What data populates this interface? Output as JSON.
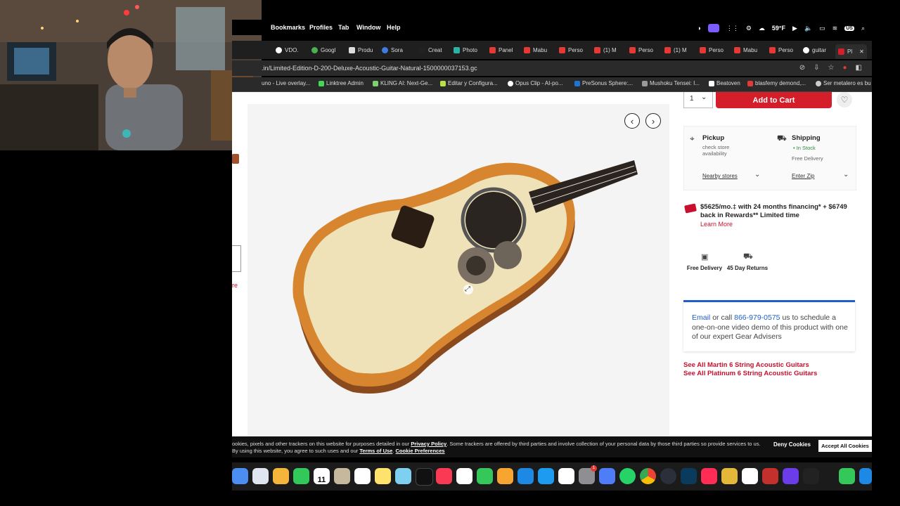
{
  "menubar": {
    "items": [
      "Bookmarks",
      "Profiles",
      "Tab",
      "Window",
      "Help"
    ],
    "status": {
      "temperature": "59°F",
      "user_badge": "US"
    }
  },
  "tabs": [
    "VDO.",
    "Googl",
    "Produ",
    "Sora",
    "Creat",
    "Photo",
    "Panel",
    "Mabu",
    "Perso",
    "(1) M",
    "Perso",
    "(1) M",
    "Perso",
    "Mabu",
    "Perso",
    "guitar",
    "Pl"
  ],
  "address": {
    "url": ".in/Limited-Edition-D-200-Deluxe-Acoustic-Guitar-Natural-1500000037153.gc"
  },
  "bookmarks": [
    "uno - Live overlay...",
    "Linktree Admin",
    "KLING AI: Next-Ge...",
    "Editar y Configura...",
    "Opus Clip - AI-po...",
    "PreSonus Sphere:...",
    "Mushoku Tensei: I...",
    "Beatoven",
    "blasfemy demond,...",
    "Ser metalero es bu"
  ],
  "product": {
    "quantity": "1",
    "add_to_cart": "Add to Cart",
    "pickup": {
      "title": "Pickup",
      "sub": "check store availability",
      "link": "Nearby stores"
    },
    "shipping": {
      "title": "Shipping",
      "stock": "• In Stock",
      "delivery": "Free Delivery",
      "link": "Enter Zip"
    },
    "financing": {
      "text": "$5625/mo.‡ with 24 months financing* + $6749 back in Rewards** Limited time",
      "learn_more": "Learn More"
    },
    "perks": [
      {
        "label": "Free Delivery"
      },
      {
        "label": "45 Day Returns"
      }
    ],
    "advisor": {
      "email": "Email",
      "or_call": "or call",
      "phone": "866-979-0575",
      "rest": "us to schedule a one-on-one video demo of this product with one of our expert Gear Advisers"
    },
    "see_all": [
      "See All Martin 6 String Acoustic Guitars",
      "See All Platinum 6 String Acoustic Guitars"
    ],
    "left_partial_text": "re"
  },
  "cookie": {
    "text_prefix": "ookies, pixels and other trackers on this website for purposes detailed in our",
    "privacy_policy": "Privacy Policy",
    "text_mid": ". Some trackers are offered by third parties and involve collection of your personal data by those third parties so provide services to us. By using this website, you agree to such uses and our",
    "terms": "Terms of Use",
    "cookie_prefs": "Cookie Preferences",
    "deny": "Deny Cookies",
    "accept": "Accept All Cookies"
  },
  "dock": {
    "calendar_day": "11",
    "badge": "1"
  },
  "colors": {
    "accent_red": "#d41e2a",
    "link_blue": "#1e5fc8",
    "stock_green": "#2e8b3a"
  }
}
